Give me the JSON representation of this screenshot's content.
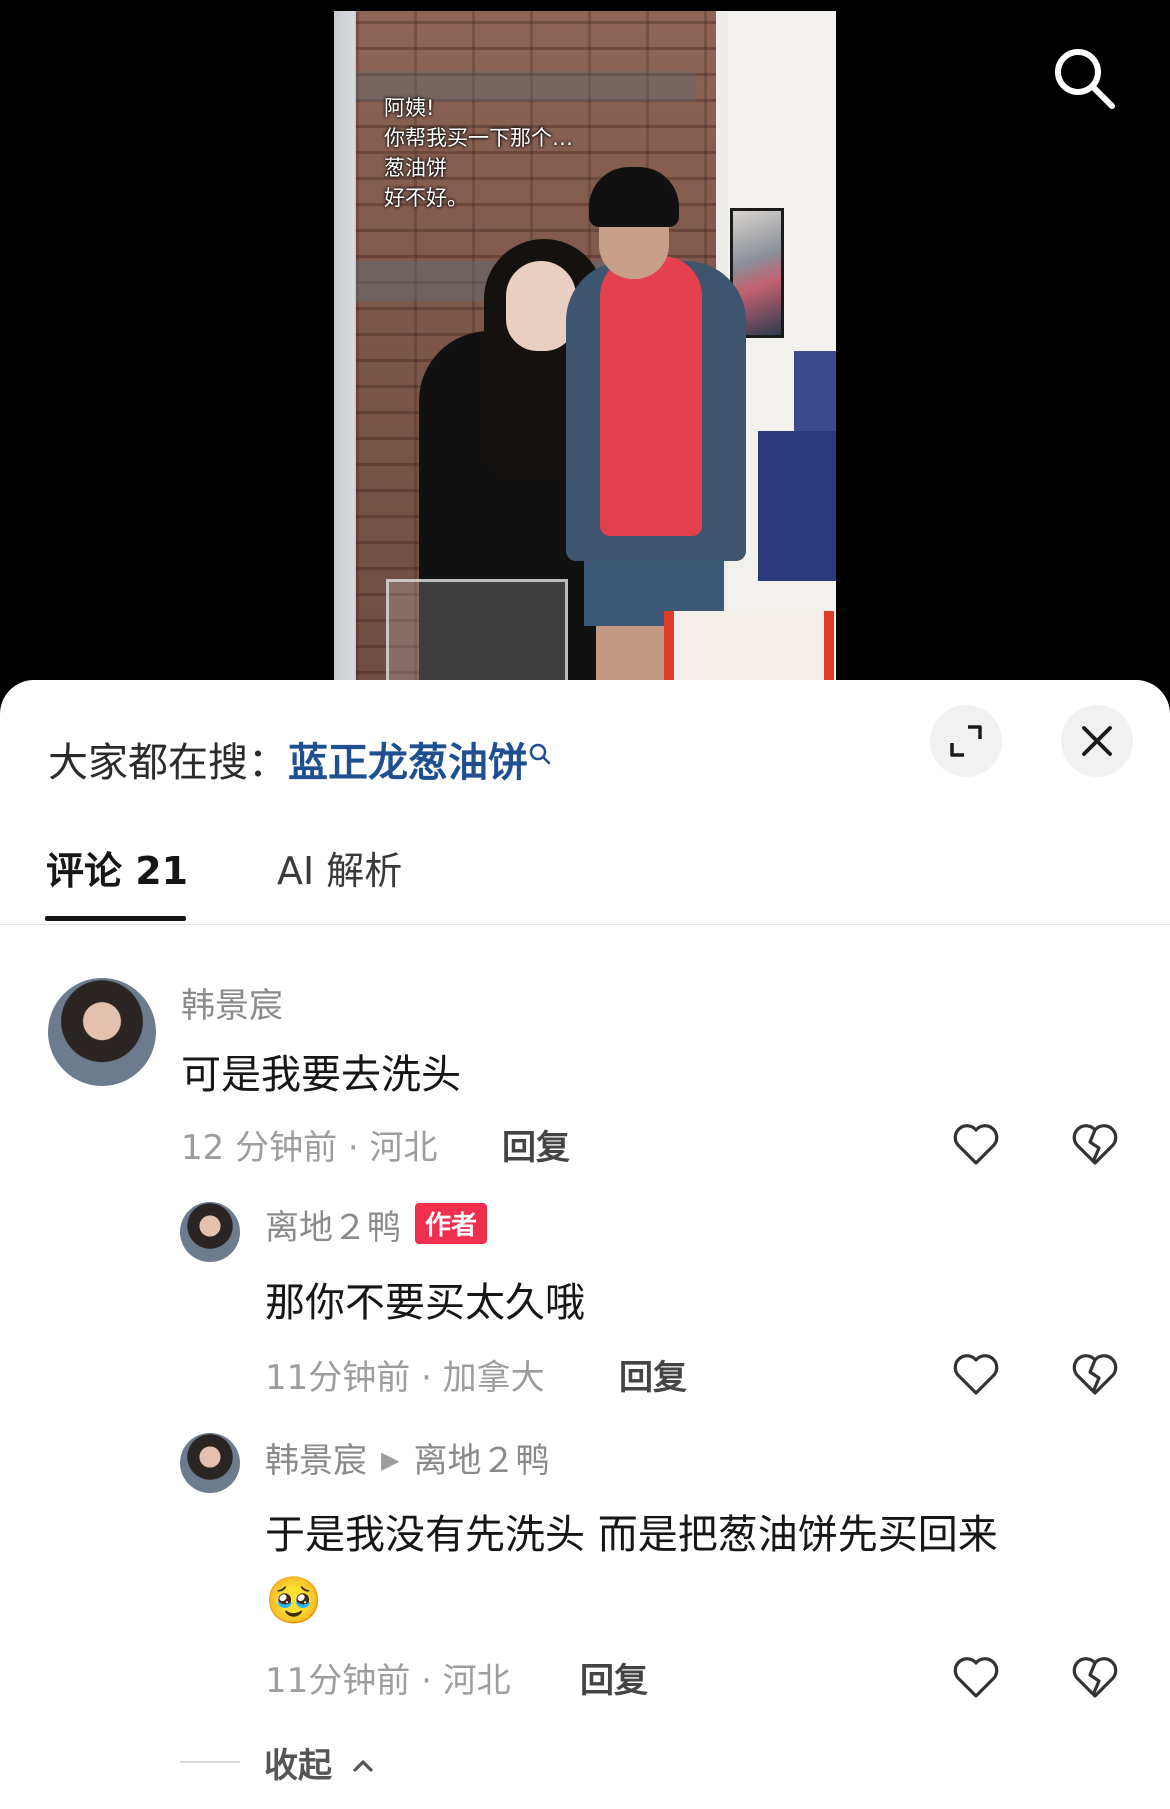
{
  "video": {
    "caption": "阿姨!\n你帮我买一下那个…\n葱油饼\n好不好。"
  },
  "search_bar": {
    "label": "大家都在搜：",
    "term": "蓝正龙葱油饼"
  },
  "tabs": [
    {
      "label": "评论 21",
      "active": true
    },
    {
      "label": "AI 解析",
      "active": false
    }
  ],
  "comments": [
    {
      "user": "韩景宸",
      "text": "可是我要去洗头",
      "time": "12 分钟前",
      "location": "河北",
      "meta": "12 分钟前 · 河北",
      "reply_label": "回复"
    },
    {
      "user": "离地２鸭",
      "badge": "作者",
      "text": "那你不要买太久哦",
      "time": "11分钟前",
      "location": "加拿大",
      "meta": "11分钟前 · 加拿大",
      "reply_label": "回复"
    },
    {
      "user": "韩景宸",
      "reply_to": "离地２鸭",
      "text": "于是我没有先洗头 而是把葱油饼先买回来",
      "emoji": "🥹",
      "time": "11分钟前",
      "location": "河北",
      "meta": "11分钟前 · 河北",
      "reply_label": "回复"
    }
  ],
  "collapse_label": "收起",
  "icons": {
    "search": "search-icon",
    "expand": "expand-icon",
    "close": "close-icon",
    "like": "heart-icon",
    "dislike": "broken-heart-icon",
    "collapse": "chevron-up-icon"
  },
  "colors": {
    "search_term": "#1d4f91",
    "author_badge": "#ef2f4d"
  }
}
